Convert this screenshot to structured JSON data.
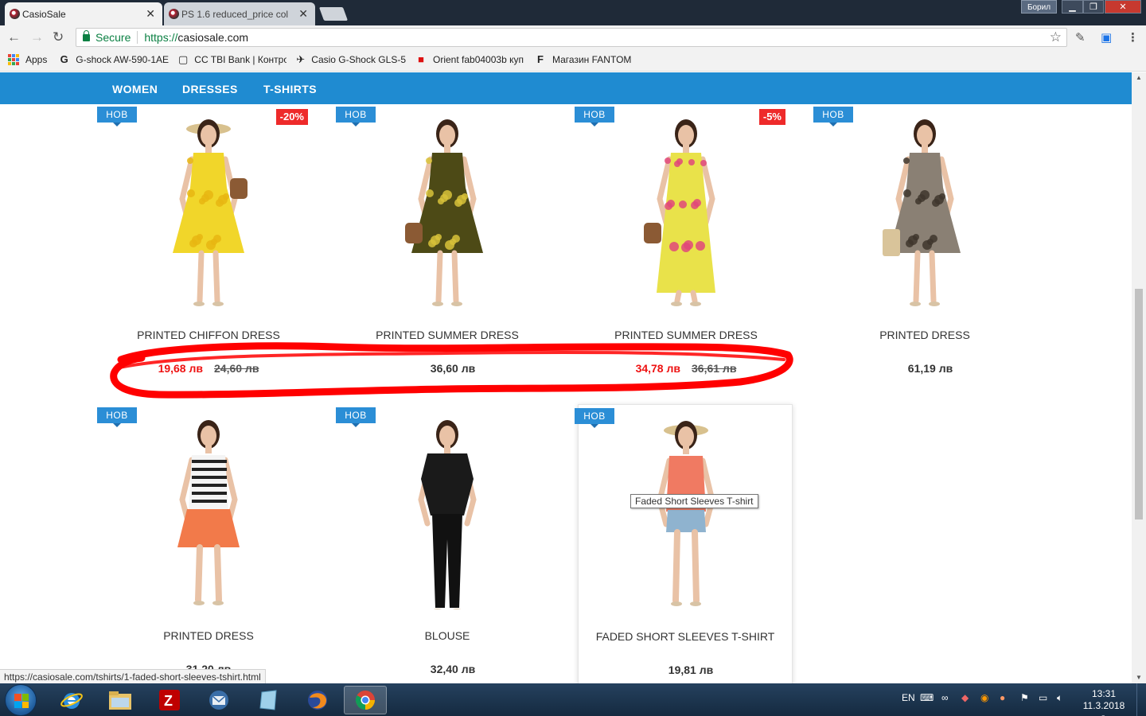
{
  "browser": {
    "tabs": [
      {
        "label": "CasioSale"
      },
      {
        "label": "PS 1.6 reduced_price col"
      }
    ],
    "user_label": "Борил",
    "omnibox": {
      "secure_label": "Secure",
      "scheme": "https://",
      "host": "casiosale.com"
    },
    "bookmarks": [
      {
        "label": "Apps",
        "icon": "apps-grid-icon"
      },
      {
        "label": "G-shock AW-590-1AE",
        "icon": "google-icon",
        "glyph": "G"
      },
      {
        "label": "CC TBI Bank | Контро",
        "icon": "page-icon",
        "glyph": "▢"
      },
      {
        "label": "Casio G-Shock GLS-5",
        "icon": "bird-icon",
        "glyph": "✈"
      },
      {
        "label": "Orient fab04003b куп",
        "icon": "orient-icon",
        "glyph": "■"
      },
      {
        "label": "Магазин FANTOM",
        "icon": "fantom-icon",
        "glyph": "F"
      }
    ],
    "status_url": "https://casiosale.com/tshirts/1-faded-short-sleeves-tshirt.html"
  },
  "nav": {
    "items": [
      "WOMEN",
      "DRESSES",
      "T-SHIRTS"
    ]
  },
  "badges": {
    "new": "НОВ"
  },
  "products": [
    {
      "name": "PRINTED CHIFFON DRESS",
      "price": "19,68 лв",
      "old_price": "24,60 лв",
      "discount": "-20%",
      "dress_color": "#f1d62a",
      "pattern_color": "#e8b612"
    },
    {
      "name": "PRINTED SUMMER DRESS",
      "price": "36,60 лв",
      "old_price": "",
      "discount": "",
      "dress_color": "#4d4a16",
      "pattern_color": "#d8c23a"
    },
    {
      "name": "PRINTED SUMMER DRESS",
      "price": "34,78 лв",
      "old_price": "36,61 лв",
      "discount": "-5%",
      "dress_color": "#e9e24a",
      "pattern_color": "#e0487a"
    },
    {
      "name": "PRINTED DRESS",
      "price": "61,19 лв",
      "old_price": "",
      "discount": "",
      "dress_color": "#8a8074",
      "pattern_color": "#3e362d"
    },
    {
      "name": "PRINTED DRESS",
      "price": "31,20 лв",
      "old_price": "",
      "discount": "",
      "dress_color": "#f27a4a",
      "pattern_color": "#222222"
    },
    {
      "name": "BLOUSE",
      "price": "32,40 лв",
      "old_price": "",
      "discount": "",
      "dress_color": "#1a1a1a",
      "pattern_color": "#111111"
    },
    {
      "name": "FADED SHORT SLEEVES T-SHIRT",
      "price": "19,81 лв",
      "old_price": "",
      "discount": "",
      "dress_color": "#f07a62",
      "pattern_color": "#8fb3cf"
    }
  ],
  "tooltip": "Faded Short Sleeves T-shirt",
  "taskbar": {
    "lang": "EN",
    "time": "13:31",
    "date": "11.3.2018 г."
  },
  "colors": {
    "accent": "#1f8bd1",
    "sale": "#e11111",
    "annotation": "#ff0000"
  }
}
